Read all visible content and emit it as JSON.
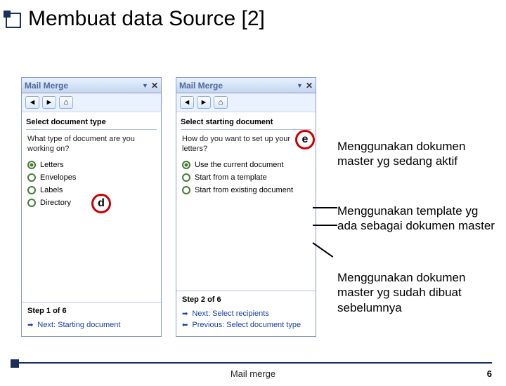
{
  "title": "Membuat data Source [2]",
  "panel1": {
    "header": "Mail Merge",
    "icons": {
      "back": "◄",
      "sep": "|",
      "home": "⌂"
    },
    "section": "Select document type",
    "question": "What type of document are you working on?",
    "options": [
      "Letters",
      "Envelopes",
      "Labels",
      "Directory"
    ],
    "step": "Step 1 of 6",
    "next": "Next: Starting document"
  },
  "panel2": {
    "header": "Mail Merge",
    "icons": {
      "back": "◄",
      "sep": "|",
      "home": "⌂"
    },
    "section": "Select starting document",
    "question": "How do you want to set up your letters?",
    "options": [
      "Use the current document",
      "Start from a template",
      "Start from existing document"
    ],
    "step": "Step 2 of 6",
    "next": "Next: Select recipients",
    "prev": "Previous: Select document type"
  },
  "callouts": {
    "d": "d",
    "e": "e"
  },
  "annotations": {
    "a1": "Menggunakan dokumen master yg sedang aktif",
    "a2": "Menggunakan template yg ada sebagai dokumen master",
    "a3": "Menggunakan dokumen master yg sudah dibuat sebelumnya"
  },
  "footer": {
    "center": "Mail merge",
    "page": "6"
  }
}
